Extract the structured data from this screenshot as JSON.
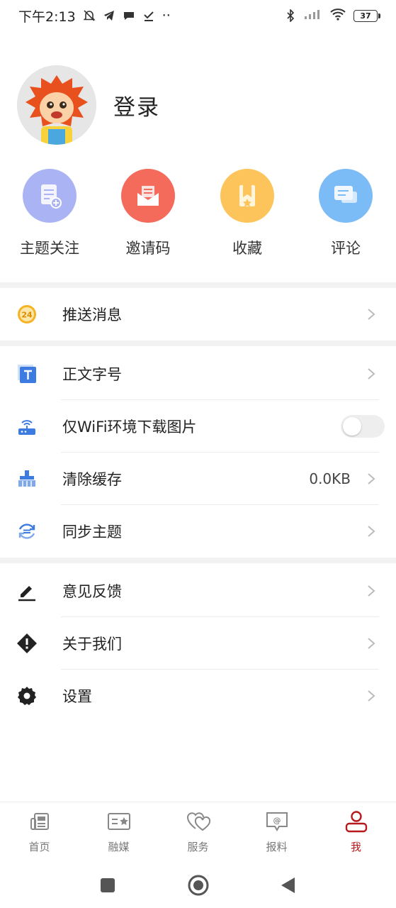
{
  "status_bar": {
    "time": "下午2:13",
    "dots": "··",
    "battery": "37"
  },
  "profile": {
    "login_label": "登录"
  },
  "shortcuts": [
    {
      "label": "主题关注",
      "color": "#aab4f4",
      "icon": "document-add-icon"
    },
    {
      "label": "邀请码",
      "color": "#f46b5b",
      "icon": "mail-open-icon"
    },
    {
      "label": "收藏",
      "color": "#fcc45a",
      "icon": "bookmark-icon"
    },
    {
      "label": "评论",
      "color": "#7bbcf7",
      "icon": "chat-bubble-icon"
    }
  ],
  "menu": {
    "push": {
      "label": "推送消息",
      "badge": "24"
    },
    "font_size": {
      "label": "正文字号"
    },
    "wifi_only": {
      "label": "仅WiFi环境下载图片",
      "enabled": false
    },
    "clear_cache": {
      "label": "清除缓存",
      "value": "0.0KB"
    },
    "sync_theme": {
      "label": "同步主题"
    },
    "feedback": {
      "label": "意见反馈"
    },
    "about": {
      "label": "关于我们"
    },
    "settings": {
      "label": "设置"
    }
  },
  "bottom_nav": [
    {
      "label": "首页",
      "icon": "newspaper-icon"
    },
    {
      "label": "融媒",
      "icon": "media-card-icon"
    },
    {
      "label": "服务",
      "icon": "hearts-icon"
    },
    {
      "label": "报料",
      "icon": "at-message-icon"
    },
    {
      "label": "我",
      "icon": "user-icon",
      "active": true
    }
  ],
  "colors": {
    "accent": "#b8191e",
    "icon_blue": "#3d7be0",
    "badge_orange": "#f5b323"
  }
}
